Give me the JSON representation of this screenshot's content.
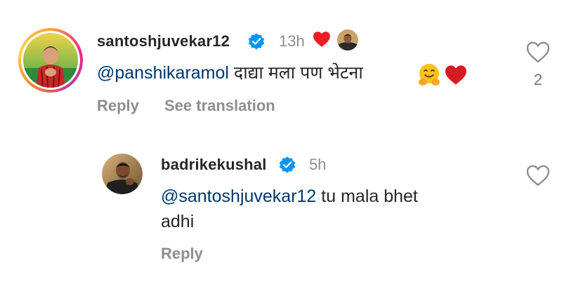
{
  "comment": {
    "username": "santoshjuvekar12",
    "time": "13h",
    "mention": "@panshikaramol",
    "text": " दाद्या मला पण भेटना",
    "reply_label": "Reply",
    "translate_label": "See translation",
    "like_count": "2"
  },
  "reply": {
    "username": "badrikekushal",
    "time": "5h",
    "mention": "@santoshjuvekar12",
    "text_line1": " tu mala bhet",
    "text_line2": "adhi",
    "reply_label": "Reply"
  },
  "colors": {
    "mention": "#00376b",
    "verified": "#0095f6",
    "heart_red": "#ed1c24",
    "secondary_text": "#8e8e8e"
  },
  "icons": [
    "verified-badge-icon",
    "heart-icon",
    "like-outline-icon",
    "hugging-face-emoji",
    "red-heart-emoji"
  ]
}
